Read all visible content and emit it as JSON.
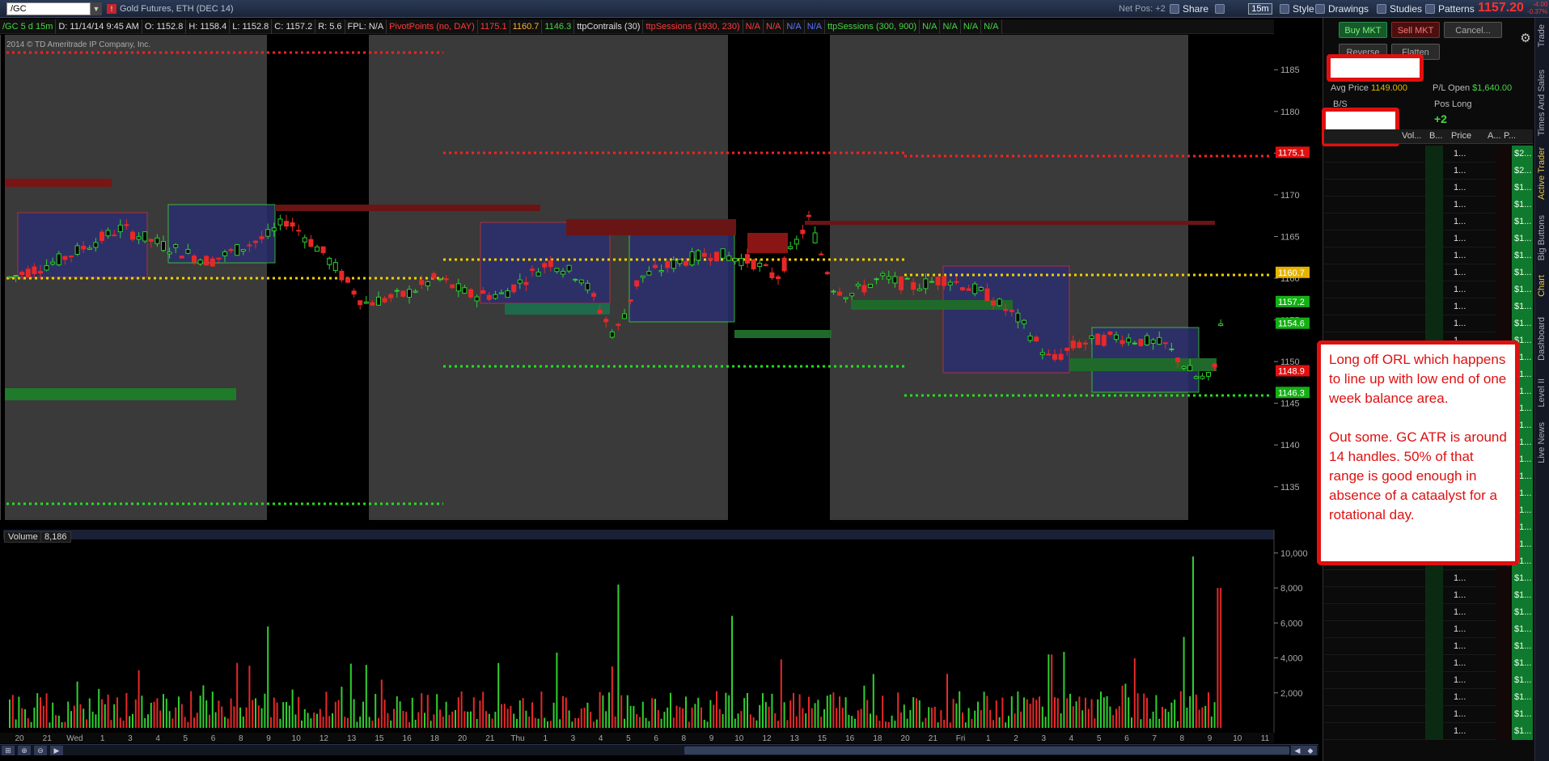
{
  "toolbar": {
    "symbol": "/GC",
    "description": "Gold Futures, ETH (DEC 14)",
    "net_pos": "Net Pos: +2",
    "share": "Share",
    "style": "Style",
    "drawings": "Drawings",
    "studies": "Studies",
    "patterns": "Patterns",
    "timeframe": "15m",
    "last_price": "1157.20",
    "change_line1": "-4.00",
    "change_line2": "-0.37%"
  },
  "infobar": {
    "symbol": "/GC 5 d 15m",
    "date": "D: 11/14/14 9:45 AM",
    "open": "O: 1152.8",
    "high": "H: 1158.4",
    "low": "L: 1152.8",
    "close": "C: 1157.2",
    "range": "R: 5.6",
    "fpl": "FPL: N/A",
    "pivot_label": "PivotPoints (no, DAY)",
    "pivot_v1": "1175.1",
    "pivot_v2": "1160.7",
    "pivot_v3": "1146.3",
    "ttp_contrails": "ttpContrails (30)",
    "ttp_sessions1": "ttpSessions (1930, 230)",
    "na1": "N/A",
    "na2": "N/A",
    "na3": "N/A",
    "na4": "N/A",
    "ttp_sessions2": "ttpSessions (300, 900)",
    "na5": "N/A",
    "na6": "N/A",
    "na7": "N/A",
    "na8": "N/A"
  },
  "copyright": "2014 © TD Ameritrade IP Company, Inc.",
  "volume": {
    "label": "Volume",
    "value": "8,186"
  },
  "chart_data": {
    "type": "candlestick",
    "price_axis": {
      "ticks": [
        1135,
        1140,
        1145,
        1150,
        1155,
        1160,
        1165,
        1170,
        1175,
        1180,
        1185
      ],
      "range": [
        1131,
        1189
      ]
    },
    "price_markers": [
      {
        "label": "1175.1",
        "color": "#e01010"
      },
      {
        "label": "1160.7",
        "color": "#e6b400"
      },
      {
        "label": "1157.2",
        "color": "#14b014"
      },
      {
        "label": "1154.6",
        "color": "#14b014"
      },
      {
        "label": "1148.9",
        "color": "#e01010"
      },
      {
        "label": "1146.3",
        "color": "#14b014"
      }
    ],
    "volume_axis": {
      "ticks": [
        "10,000",
        "8,000",
        "6,000",
        "4,000",
        "2,000"
      ],
      "values": [
        10000,
        8000,
        6000,
        4000,
        2000
      ]
    },
    "x_labels": [
      "20",
      "21",
      "Wed",
      "1",
      "3",
      "4",
      "5",
      "6",
      "8",
      "9",
      "10",
      "12",
      "13",
      "15",
      "16",
      "18",
      "20",
      "21",
      "Thu",
      "1",
      "3",
      "4",
      "5",
      "6",
      "8",
      "9",
      "10",
      "12",
      "13",
      "15",
      "16",
      "18",
      "20",
      "21",
      "Fri",
      "1",
      "2",
      "3",
      "4",
      "5",
      "6",
      "7",
      "8",
      "9",
      "10",
      "11"
    ]
  },
  "order_panel": {
    "buy": "Buy MKT",
    "sell": "Sell MKT",
    "cancel": "Cancel...",
    "reverse": "Reverse",
    "flatten": "Flatten",
    "avg_price_label": "Avg Price",
    "avg_price": "1149.000",
    "pl_open_label": "P/L Open",
    "pl_open": "$1,640.00",
    "bs_label": "B/S",
    "pos_label": "Pos Long",
    "pos_value": "+2"
  },
  "ladder": {
    "headers": {
      "volume": "Vol...",
      "bid": "B...",
      "price": "Price",
      "ask": "A...",
      "pl": "P..."
    },
    "price_cell": "1...",
    "pl_cells": [
      "$2...",
      "$2...",
      "$1...",
      "$1...",
      "$1...",
      "$1...",
      "$1...",
      "$1...",
      "$1...",
      "$1...",
      "$1...",
      "$1...",
      "$1...",
      "$1...",
      "$1...",
      "$1...",
      "$1...",
      "$1...",
      "$1...",
      "$1...",
      "$1...",
      "$1...",
      "$1...",
      "$1...",
      "$1...",
      "$1...",
      "$1...",
      "$1...",
      "$1...",
      "$1...",
      "$1...",
      "$1...",
      "$1...",
      "$1...",
      "$1..."
    ]
  },
  "right_tabs": [
    "Trade",
    "Times And Sales",
    "Active Trader",
    "Big Buttons",
    "Chart",
    "Dashboard",
    "Level II",
    "Live News"
  ],
  "note": {
    "para1": "Long off ORL which happens to line up with low end of one week balance area.",
    "para2": "Out some. GC ATR is around 14 handles. 50% of that range is good enough in absence of a cataalyst for a rotational day."
  }
}
